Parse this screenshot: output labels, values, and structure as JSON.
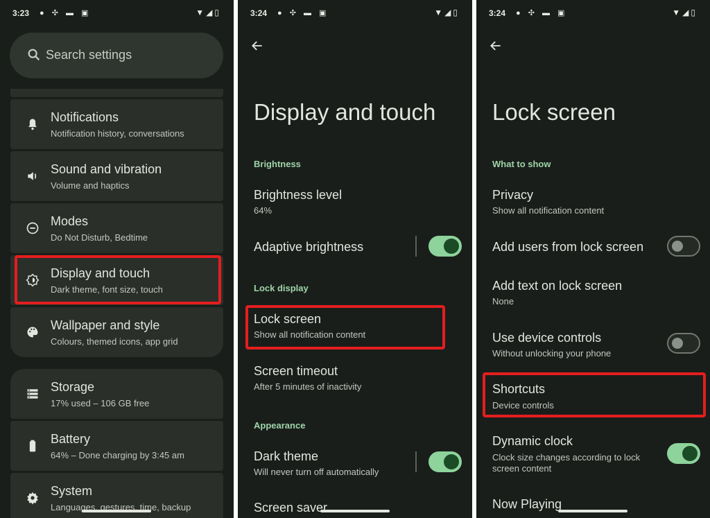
{
  "panel1": {
    "status": {
      "time": "3:23"
    },
    "search": {
      "placeholder": "Search settings"
    },
    "items": [
      {
        "title": "Notifications",
        "subtitle": "Notification history, conversations",
        "icon": "bell-icon"
      },
      {
        "title": "Sound and vibration",
        "subtitle": "Volume and haptics",
        "icon": "speaker-icon"
      },
      {
        "title": "Modes",
        "subtitle": "Do Not Disturb, Bedtime",
        "icon": "minus-circle-icon"
      },
      {
        "title": "Display and touch",
        "subtitle": "Dark theme, font size, touch",
        "icon": "brightness-icon"
      },
      {
        "title": "Wallpaper and style",
        "subtitle": "Colours, themed icons, app grid",
        "icon": "palette-icon"
      },
      {
        "title": "Storage",
        "subtitle": "17% used – 106 GB free",
        "icon": "storage-icon"
      },
      {
        "title": "Battery",
        "subtitle": "64% – Done charging by 3:45 am",
        "icon": "battery-icon"
      },
      {
        "title": "System",
        "subtitle": "Languages, gestures, time, backup",
        "icon": "gear-icon"
      }
    ]
  },
  "panel2": {
    "status": {
      "time": "3:24"
    },
    "title": "Display and touch",
    "section_brightness": "Brightness",
    "brightness_level": {
      "title": "Brightness level",
      "subtitle": "64%"
    },
    "adaptive_brightness": {
      "title": "Adaptive brightness",
      "enabled": true
    },
    "section_lock": "Lock display",
    "lock_screen": {
      "title": "Lock screen",
      "subtitle": "Show all notification content"
    },
    "screen_timeout": {
      "title": "Screen timeout",
      "subtitle": "After 5 minutes of inactivity"
    },
    "section_appearance": "Appearance",
    "dark_theme": {
      "title": "Dark theme",
      "subtitle": "Will never turn off automatically",
      "enabled": true
    },
    "screen_saver": {
      "title": "Screen saver"
    }
  },
  "panel3": {
    "status": {
      "time": "3:24"
    },
    "title": "Lock screen",
    "section_what": "What to show",
    "privacy": {
      "title": "Privacy",
      "subtitle": "Show all notification content"
    },
    "add_users": {
      "title": "Add users from lock screen",
      "enabled": false
    },
    "add_text": {
      "title": "Add text on lock screen",
      "subtitle": "None"
    },
    "device_controls": {
      "title": "Use device controls",
      "subtitle": "Without unlocking your phone",
      "enabled": false
    },
    "shortcuts": {
      "title": "Shortcuts",
      "subtitle": "Device controls"
    },
    "dynamic_clock": {
      "title": "Dynamic clock",
      "subtitle_1": "Clock size changes according to lock",
      "subtitle_2": "screen content",
      "enabled": true
    },
    "now_playing": {
      "title": "Now Playing"
    }
  },
  "colors": {
    "background": "#1a1e1b",
    "card": "#2a2f2a",
    "accent": "#8dd39b",
    "section": "#9fd4a8",
    "highlight": "#e41e1e"
  }
}
